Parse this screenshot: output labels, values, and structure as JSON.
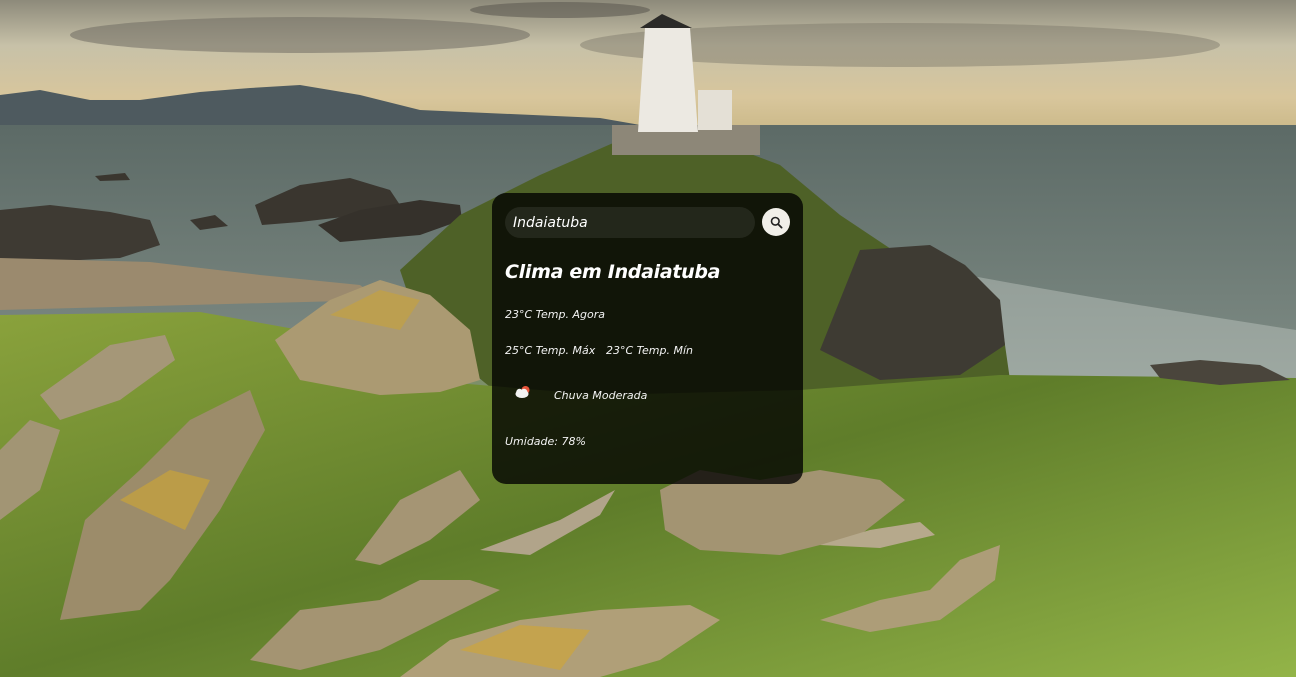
{
  "search": {
    "value": "Indaiatuba",
    "placeholder": "Indaiatuba",
    "button_icon": "search-icon"
  },
  "weather": {
    "title": "Clima em Indaiatuba",
    "temp_now": "23°C Temp. Agora",
    "temp_max": "25°C Temp. Máx",
    "temp_min": "23°C Temp. Mín",
    "condition_icon": "cloud-rain-icon",
    "condition": "Chuva Moderada",
    "humidity": "Umidade: 78%"
  },
  "background": {
    "description_icon": "lighthouse-landscape",
    "colors": {
      "sky": "#c9b58c",
      "sea": "#5f6f68",
      "grass": "#7f9f3f",
      "card": "rgba(0,0,0,0.78)"
    }
  }
}
